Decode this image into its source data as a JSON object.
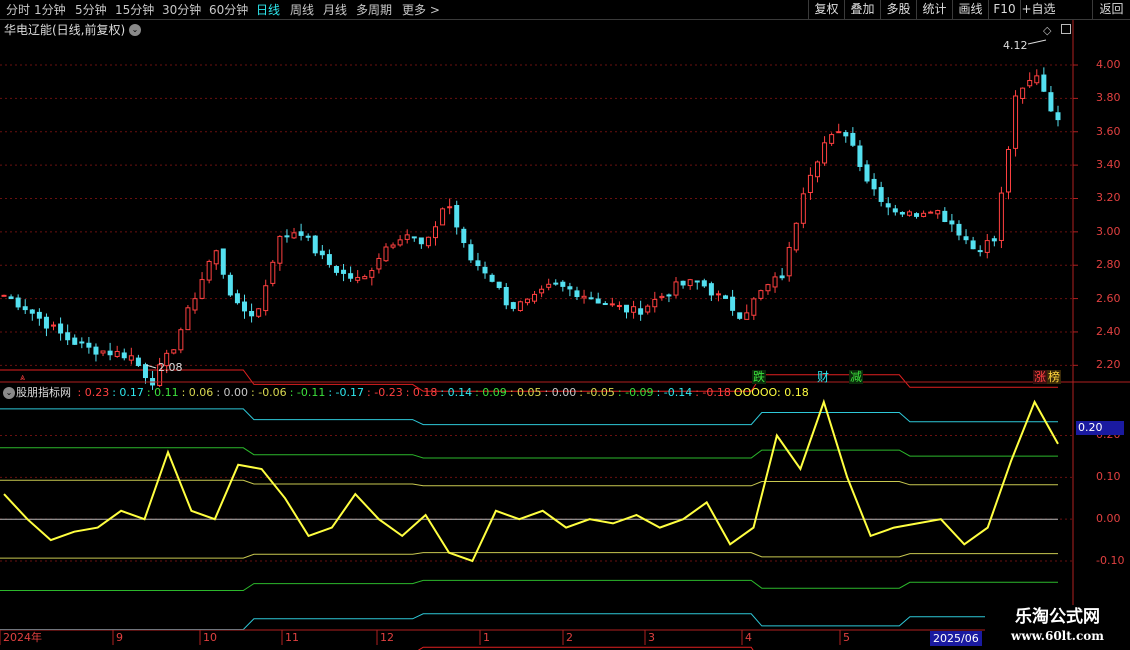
{
  "toolbar": {
    "periods": [
      "分时",
      "1分钟",
      "5分钟",
      "15分钟",
      "30分钟",
      "60分钟",
      "日线",
      "周线",
      "月线",
      "多周期",
      "更多 >"
    ],
    "active_period": "日线",
    "right_buttons": [
      "复权",
      "叠加",
      "多股",
      "统计",
      "画线",
      "F10",
      "+自选",
      "返回"
    ]
  },
  "main_chart": {
    "title": "华电辽能(日线,前复权)",
    "high_label": "4.12",
    "low_label": "2.08",
    "y_axis_ticks": [
      "4.00",
      "3.80",
      "3.60",
      "3.40",
      "3.20",
      "3.00",
      "2.80",
      "2.60",
      "2.40",
      "2.20"
    ],
    "signals": [
      {
        "text": "跌",
        "color": "#3ce03c"
      },
      {
        "text": "财",
        "color": "#2ee8ee"
      },
      {
        "text": "减",
        "color": "#3ce03c"
      },
      {
        "text": "涨",
        "color": "#ff4040"
      },
      {
        "text": "榜",
        "color": "#ffd23c"
      }
    ]
  },
  "indicator": {
    "name": "股朋指标网",
    "values": [
      {
        "text": ": 0.23",
        "color": "#ff4040"
      },
      {
        "text": ": 0.17",
        "color": "#2ee8ee"
      },
      {
        "text": ": 0.11",
        "color": "#3ce03c"
      },
      {
        "text": ": 0.06",
        "color": "#d8d850"
      },
      {
        "text": ": 0.00",
        "color": "#c8c8c8"
      },
      {
        "text": ": -0.06",
        "color": "#d8d850"
      },
      {
        "text": ": -0.11",
        "color": "#3ce03c"
      },
      {
        "text": ": -0.17",
        "color": "#2ee8ee"
      },
      {
        "text": ": -0.23",
        "color": "#ff4040"
      },
      {
        "text": ": 0.18",
        "color": "#ff4040"
      },
      {
        "text": ": 0.14",
        "color": "#2ee8ee"
      },
      {
        "text": ": 0.09",
        "color": "#3ce03c"
      },
      {
        "text": ": 0.05",
        "color": "#d8d850"
      },
      {
        "text": ": 0.00",
        "color": "#c8c8c8"
      },
      {
        "text": ": -0.05",
        "color": "#d8d850"
      },
      {
        "text": ": -0.09",
        "color": "#3ce03c"
      },
      {
        "text": ": -0.14",
        "color": "#2ee8ee"
      },
      {
        "text": ": -0.18",
        "color": "#ff4040"
      },
      {
        "text": "OOOOO: 0.18",
        "color": "#ffff40"
      }
    ],
    "y_axis_ticks": [
      "0.20",
      "0.10",
      "0.00",
      "-0.10"
    ],
    "current_value": "0.20"
  },
  "x_axis": {
    "labels": [
      "2024年",
      "9",
      "10",
      "11",
      "12",
      "1",
      "2",
      "3",
      "4",
      "5"
    ],
    "current_date": "2025/06"
  },
  "watermark": {
    "title": "乐淘公式网",
    "url": "www.60lt.com"
  },
  "colors": {
    "up": "#ff4040",
    "down": "#54e0f0",
    "grid": "#7a1010",
    "axis": "#b02020"
  },
  "chart_data": {
    "type": "candlestick",
    "title": "华电辽能(日线,前复权)",
    "y_axis": {
      "min": 2.1,
      "max": 4.15,
      "ticks": [
        2.2,
        2.4,
        2.6,
        2.8,
        3.0,
        3.2,
        3.4,
        3.6,
        3.8,
        4.0
      ]
    },
    "x_labels": [
      "2024年",
      "9",
      "10",
      "11",
      "12",
      "1",
      "2",
      "3",
      "4",
      "5",
      "2025/06"
    ],
    "close_path_approx": [
      2.62,
      2.55,
      2.45,
      2.36,
      2.3,
      2.28,
      2.26,
      2.1,
      2.3,
      2.6,
      2.9,
      2.55,
      2.5,
      2.95,
      3.02,
      2.85,
      2.75,
      2.7,
      2.9,
      3.0,
      2.9,
      3.2,
      2.85,
      2.75,
      2.55,
      2.58,
      2.68,
      2.65,
      2.6,
      2.55,
      2.52,
      2.6,
      2.68,
      2.7,
      2.6,
      2.5,
      2.65,
      2.75,
      3.3,
      3.55,
      3.6,
      3.3,
      3.15,
      3.1,
      3.15,
      3.05,
      2.9,
      2.95,
      3.8,
      3.95,
      3.65
    ],
    "high": 4.12,
    "low": 2.08,
    "indicator": {
      "name": "股朋指标网",
      "y_axis": {
        "min": -0.26,
        "max": 0.28,
        "ticks": [
          0.2,
          0.1,
          0.0,
          -0.1
        ]
      },
      "bands": [
        0.23,
        0.17,
        0.11,
        0.06,
        0.0,
        -0.06,
        -0.11,
        -0.17,
        -0.23
      ],
      "current_band_values": [
        0.18,
        0.14,
        0.09,
        0.05,
        0.0,
        -0.05,
        -0.09,
        -0.14,
        -0.18
      ],
      "series": [
        {
          "name": "OOOOO",
          "last": 0.18,
          "values": [
            0.06,
            0.0,
            -0.05,
            -0.03,
            -0.02,
            0.02,
            0.0,
            0.16,
            0.02,
            0.0,
            0.13,
            0.12,
            0.05,
            -0.04,
            -0.02,
            0.06,
            0.0,
            -0.04,
            0.01,
            -0.08,
            -0.1,
            0.02,
            0.0,
            0.02,
            -0.02,
            0.0,
            -0.01,
            0.01,
            -0.02,
            0.0,
            0.04,
            -0.06,
            -0.02,
            0.2,
            0.12,
            0.28,
            0.1,
            -0.04,
            -0.02,
            -0.01,
            0.0,
            -0.06,
            -0.02,
            0.14,
            0.28,
            0.18
          ]
        }
      ]
    }
  }
}
